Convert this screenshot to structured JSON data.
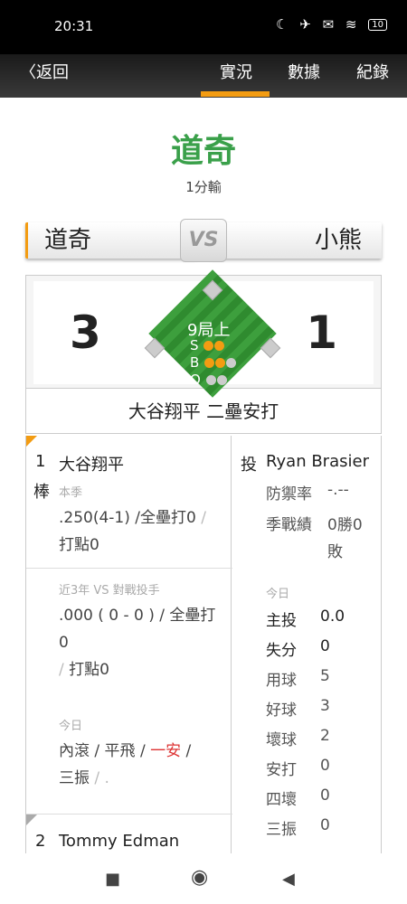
{
  "status": {
    "time": "20:31",
    "icons": "☾ ✈ ✉ ≋",
    "battery": "10"
  },
  "nav": {
    "back": "〈返回",
    "tabs": [
      "實況",
      "數據",
      "紀錄"
    ],
    "active_tab": "實況"
  },
  "game": {
    "winner": "道奇",
    "result": "1分輸",
    "away_team": "道奇",
    "home_team": "小熊",
    "vs_label": "VS",
    "away_score": "3",
    "home_score": "1",
    "inning": "9局上",
    "count": {
      "S_label": "S",
      "B_label": "B",
      "O_label": "O",
      "strikes": 2,
      "balls": 2,
      "outs": 0
    },
    "play": "大谷翔平 二壘安打"
  },
  "batter": {
    "order": "1",
    "bat_label": "棒",
    "name": "大谷翔平",
    "season_label": "本季",
    "season_avg": ".250(4-1)",
    "season_sep1": "/",
    "season_hr": "全壘打0",
    "season_sep2": "/",
    "season_rbi": "打點0",
    "vs_label": "近3年 VS 對戰投手",
    "vs_line1": ".000 ( 0 - 0 ) / 全壘打",
    "vs_line2": "0",
    "vs_line3_sep": "/",
    "vs_line3": "打點0",
    "today_label": "今日",
    "today_1": "內滾",
    "today_sep1": " / ",
    "today_2": "平飛",
    "today_sep2": " / ",
    "today_hit": "一安",
    "today_sep3": " / ",
    "today_3": "三振",
    "today_sep4": " / .",
    "next_order": "2",
    "next_name": "Tommy Edman"
  },
  "pitcher": {
    "label": "投",
    "name": "Ryan Brasier",
    "era_label": "防禦率",
    "era": "-.--",
    "record_label": "季戰績",
    "record_1": "0勝0",
    "record_2": "敗",
    "today_label": "今日",
    "stats": [
      {
        "label": "主投",
        "value": "0.0"
      },
      {
        "label": "失分",
        "value": "0"
      },
      {
        "label": "用球",
        "value": "5"
      },
      {
        "label": "好球",
        "value": "3"
      },
      {
        "label": "壞球",
        "value": "2"
      },
      {
        "label": "安打",
        "value": "0"
      },
      {
        "label": "四壞",
        "value": "0"
      },
      {
        "label": "三振",
        "value": "0"
      }
    ]
  },
  "sysnav": {
    "recent": "■",
    "home": "◉",
    "back": "◀"
  },
  "colors": {
    "accent": "#f39c12",
    "winner": "#3aa04a",
    "field": "#3d9f3d",
    "hit": "#dd3333"
  }
}
